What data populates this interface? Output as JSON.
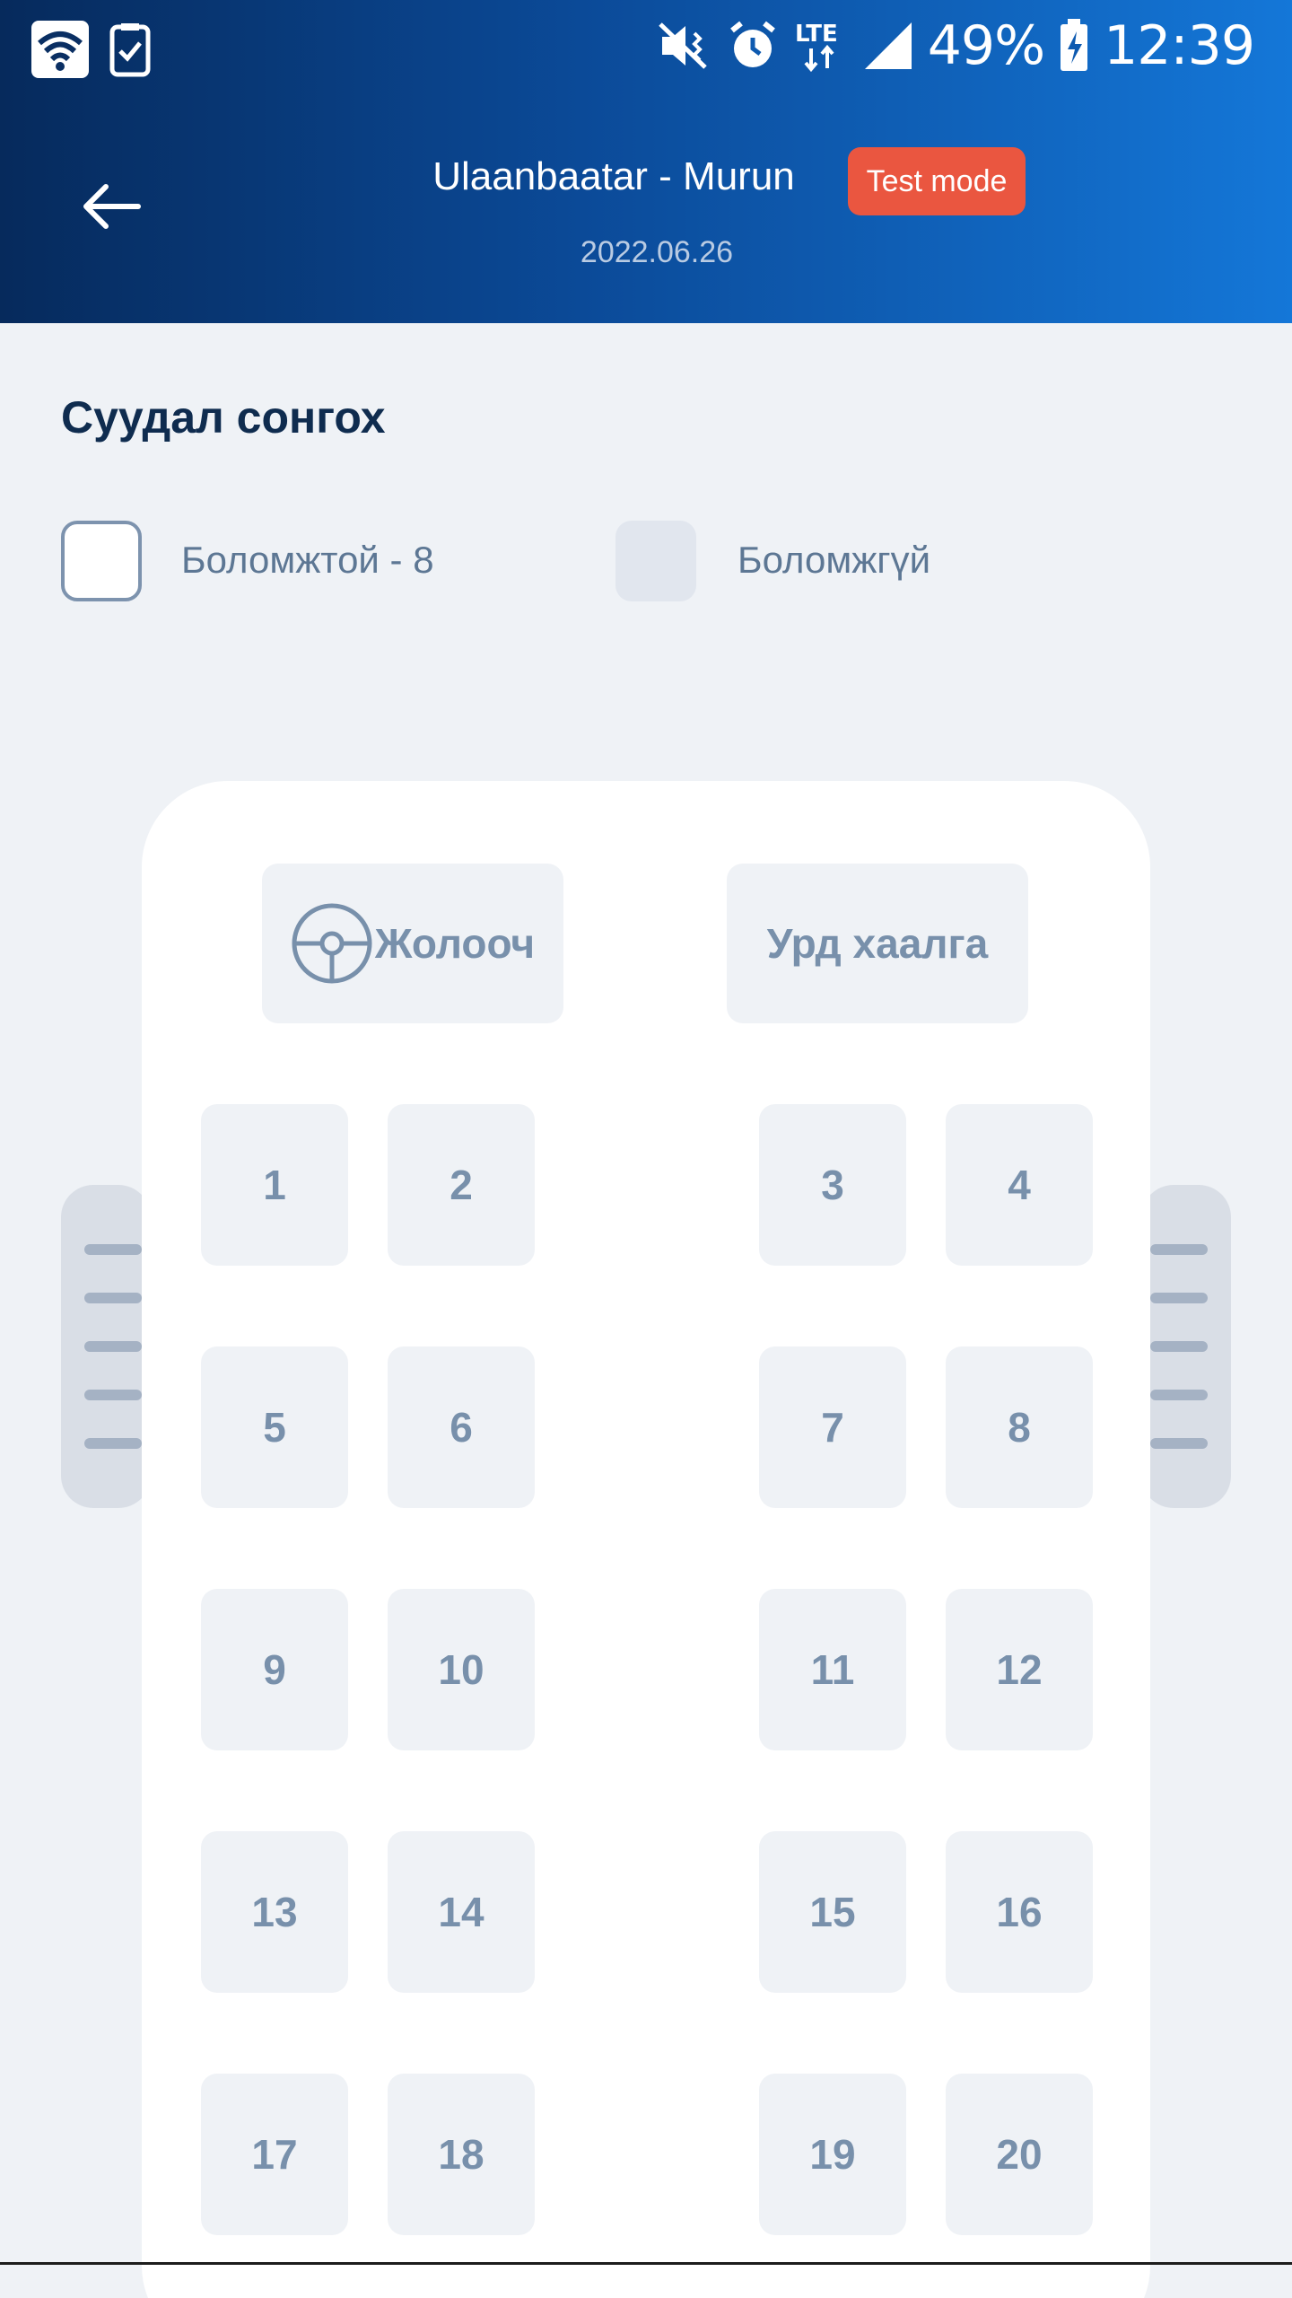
{
  "status_bar": {
    "battery": "49%",
    "time": "12:39",
    "network": "LTE",
    "icons": [
      "wifi-icon",
      "task-check-icon",
      "mute-vibrate-icon",
      "alarm-icon",
      "signal-icon",
      "battery-charging-icon"
    ]
  },
  "app_bar": {
    "title": "Ulaanbaatar - Murun",
    "date": "2022.06.26",
    "badge": "Test mode",
    "back_icon": "arrow-left-icon"
  },
  "section": {
    "title": "Суудал сонгох",
    "legend": {
      "available": "Боломжтой - 8",
      "unavailable": "Боломжгүй"
    }
  },
  "bus": {
    "driver_label": "Жолооч",
    "door_label": "Урд хаалга",
    "seats": [
      "1",
      "2",
      "3",
      "4",
      "5",
      "6",
      "7",
      "8",
      "9",
      "10",
      "11",
      "12",
      "13",
      "14",
      "15",
      "16",
      "17",
      "18",
      "19",
      "20"
    ]
  },
  "colors": {
    "header_start": "#062a5c",
    "header_end": "#1477d8",
    "badge": "#ea5640",
    "seat_bg": "#eff2f6",
    "seat_text": "#7890ab",
    "title_text": "#0f2c4f"
  }
}
